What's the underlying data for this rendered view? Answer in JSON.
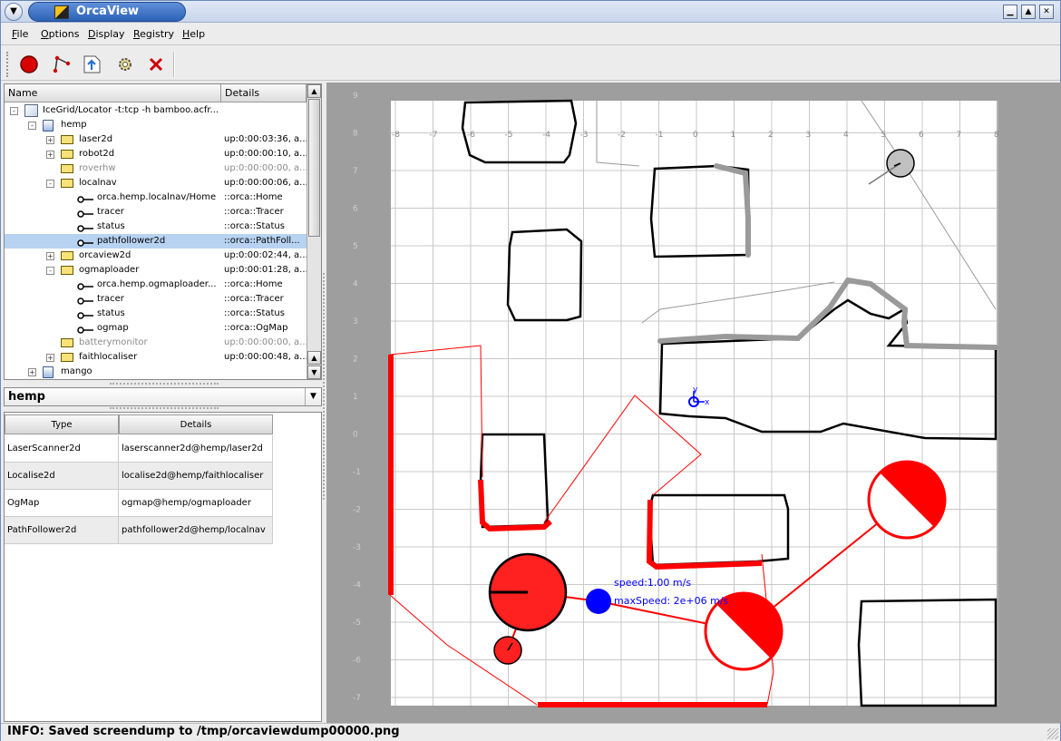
{
  "window": {
    "title": "OrcaView"
  },
  "menu": [
    "File",
    "Options",
    "Display",
    "Registry",
    "Help"
  ],
  "toolbar": {
    "icons": [
      "record-icon",
      "path-icon",
      "export-icon",
      "settings-icon",
      "delete-icon"
    ]
  },
  "tree": {
    "headers": {
      "name": "Name",
      "details": "Details"
    },
    "rows": [
      {
        "level": 0,
        "icon": "doc",
        "name": "IceGrid/Locator -t:tcp -h bamboo.acfr...",
        "details": "",
        "expander": "-",
        "greyed": false
      },
      {
        "level": 1,
        "icon": "host",
        "name": "hemp",
        "details": "",
        "expander": "-",
        "greyed": false
      },
      {
        "level": 2,
        "icon": "folder",
        "name": "laser2d",
        "details": "up:0:00:03:36, a...",
        "expander": "+",
        "greyed": false
      },
      {
        "level": 2,
        "icon": "folder",
        "name": "robot2d",
        "details": "up:0:00:00:10, a...",
        "expander": "+",
        "greyed": false
      },
      {
        "level": 2,
        "icon": "folder",
        "name": "roverhw",
        "details": "up:0:00:00:00, a...",
        "expander": "",
        "greyed": true
      },
      {
        "level": 2,
        "icon": "folder",
        "name": "localnav",
        "details": "up:0:00:00:06, a...",
        "expander": "-",
        "greyed": false
      },
      {
        "level": 3,
        "icon": "iface",
        "name": "orca.hemp.localnav/Home",
        "details": "::orca::Home",
        "expander": "",
        "greyed": false
      },
      {
        "level": 3,
        "icon": "iface",
        "name": "tracer",
        "details": "::orca::Tracer",
        "expander": "",
        "greyed": false
      },
      {
        "level": 3,
        "icon": "iface",
        "name": "status",
        "details": "::orca::Status",
        "expander": "",
        "greyed": false
      },
      {
        "level": 3,
        "icon": "iface",
        "name": "pathfollower2d",
        "details": "::orca::PathFoll...",
        "expander": "",
        "greyed": false,
        "selected": true
      },
      {
        "level": 2,
        "icon": "folder",
        "name": "orcaview2d",
        "details": "up:0:00:02:44, a...",
        "expander": "+",
        "greyed": false
      },
      {
        "level": 2,
        "icon": "folder",
        "name": "ogmaploader",
        "details": "up:0:00:01:28, a...",
        "expander": "-",
        "greyed": false
      },
      {
        "level": 3,
        "icon": "iface",
        "name": "orca.hemp.ogmaploader...",
        "details": "::orca::Home",
        "expander": "",
        "greyed": false
      },
      {
        "level": 3,
        "icon": "iface",
        "name": "tracer",
        "details": "::orca::Tracer",
        "expander": "",
        "greyed": false
      },
      {
        "level": 3,
        "icon": "iface",
        "name": "status",
        "details": "::orca::Status",
        "expander": "",
        "greyed": false
      },
      {
        "level": 3,
        "icon": "iface",
        "name": "ogmap",
        "details": "::orca::OgMap",
        "expander": "",
        "greyed": false
      },
      {
        "level": 2,
        "icon": "folder",
        "name": "batterymonitor",
        "details": "up:0:00:00:00, a...",
        "expander": "",
        "greyed": true
      },
      {
        "level": 2,
        "icon": "folder",
        "name": "faithlocaliser",
        "details": "up:0:00:00:48, a...",
        "expander": "+",
        "greyed": false
      },
      {
        "level": 1,
        "icon": "host",
        "name": "mango",
        "details": "",
        "expander": "+",
        "greyed": false
      }
    ]
  },
  "combo": {
    "value": "hemp"
  },
  "table": {
    "headers": [
      "Type",
      "Details"
    ],
    "rows": [
      [
        "LaserScanner2d",
        "laserscanner2d@hemp/laser2d"
      ],
      [
        "Localise2d",
        "localise2d@hemp/faithlocaliser"
      ],
      [
        "OgMap",
        "ogmap@hemp/ogmaploader"
      ],
      [
        "PathFollower2d",
        "pathfollower2d@hemp/localnav"
      ]
    ]
  },
  "map": {
    "x_ticks": [
      "-8",
      "-7",
      "-6",
      "-5",
      "-4",
      "-3",
      "-2",
      "-1",
      "0",
      "1",
      "2",
      "3",
      "4",
      "5",
      "6",
      "7",
      "8"
    ],
    "y_ticks": [
      "9",
      "8",
      "7",
      "6",
      "5",
      "4",
      "3",
      "2",
      "1",
      "0",
      "-1",
      "-2",
      "-3",
      "-4",
      "-5",
      "-6",
      "-7",
      "-8"
    ],
    "axis_x_label": "x",
    "axis_y_label": "y",
    "speed_text": "speed:1.00 m/s",
    "max_speed_text": "maxSpeed: 2e+06 m/s",
    "colors": {
      "laser": "#ff0000",
      "grid": "#c8c8c8",
      "wall": "#000000",
      "trace": "#9a9a9a",
      "goal": "#0000ff"
    }
  },
  "status": {
    "message": "INFO: Saved screendump to /tmp/orcaviewdump00000.png"
  }
}
